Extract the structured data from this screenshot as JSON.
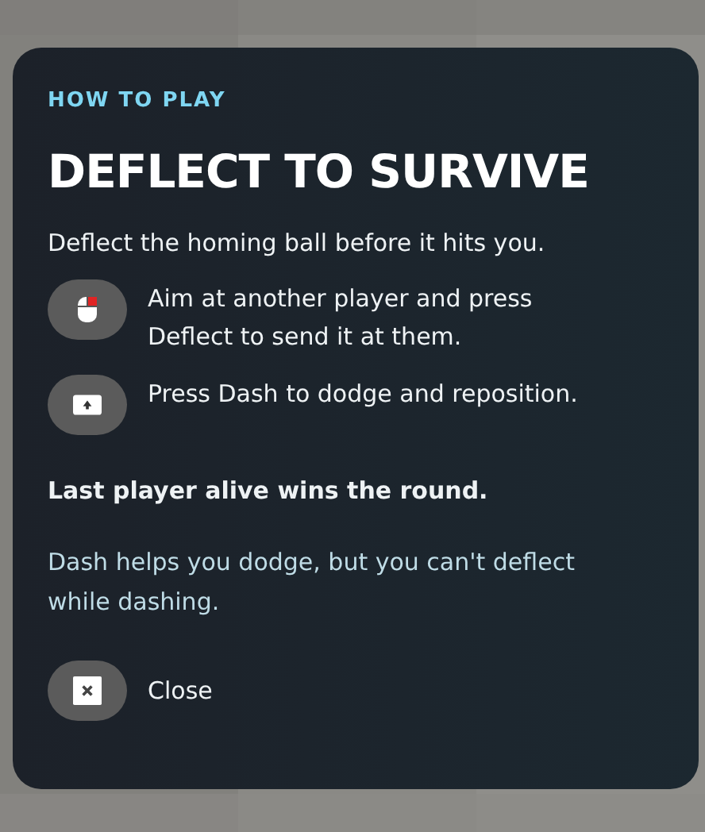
{
  "card": {
    "eyebrow": "HOW TO PLAY",
    "title": "DEFLECT TO SURVIVE",
    "intro": "Deflect the homing ball before it hits you.",
    "controls": [
      {
        "kind": "mouse",
        "text": "Aim at another player and press Deflect to send it at them."
      },
      {
        "kind": "key",
        "text": "Press Dash to dodge and reposition."
      }
    ],
    "goal": "Last player alive wins the round.",
    "tip": "Dash helps you dodge, but you can't deflect while dashing.",
    "close": {
      "label": "Close"
    }
  }
}
